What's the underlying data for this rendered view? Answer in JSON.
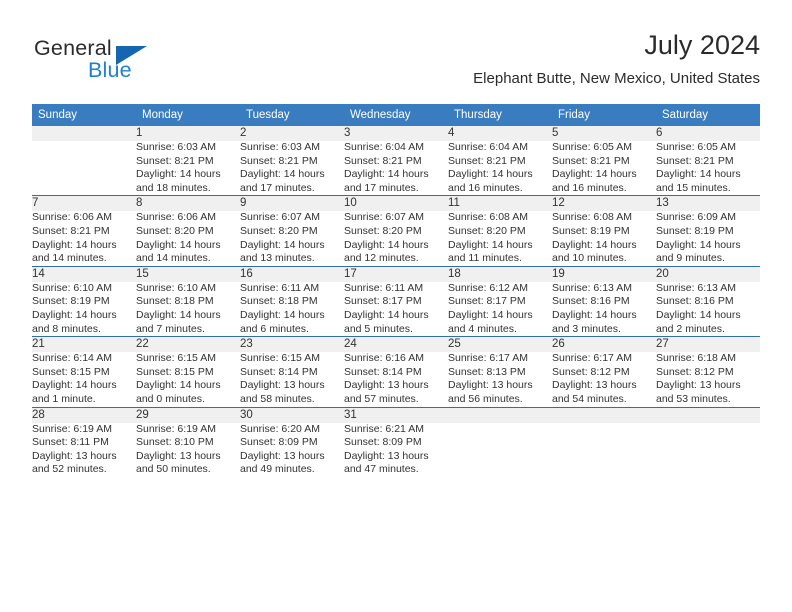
{
  "brand": {
    "name_top": "General",
    "name_bottom": "Blue",
    "accent_color": "#1f7fd0",
    "triangle_color": "#1565b0"
  },
  "header": {
    "title": "July 2024",
    "subtitle": "Elephant Butte, New Mexico, United States"
  },
  "theme": {
    "header_bg": "#3a7cc0",
    "daynum_bg": "#f0f0f0",
    "row_divider": "#2f6fae",
    "text": "#333333"
  },
  "weekdays": [
    "Sunday",
    "Monday",
    "Tuesday",
    "Wednesday",
    "Thursday",
    "Friday",
    "Saturday"
  ],
  "weeks": [
    {
      "days": [
        {
          "num": "",
          "sunrise": "",
          "sunset": "",
          "daylight1": "",
          "daylight2": ""
        },
        {
          "num": "1",
          "sunrise": "Sunrise: 6:03 AM",
          "sunset": "Sunset: 8:21 PM",
          "daylight1": "Daylight: 14 hours",
          "daylight2": "and 18 minutes."
        },
        {
          "num": "2",
          "sunrise": "Sunrise: 6:03 AM",
          "sunset": "Sunset: 8:21 PM",
          "daylight1": "Daylight: 14 hours",
          "daylight2": "and 17 minutes."
        },
        {
          "num": "3",
          "sunrise": "Sunrise: 6:04 AM",
          "sunset": "Sunset: 8:21 PM",
          "daylight1": "Daylight: 14 hours",
          "daylight2": "and 17 minutes."
        },
        {
          "num": "4",
          "sunrise": "Sunrise: 6:04 AM",
          "sunset": "Sunset: 8:21 PM",
          "daylight1": "Daylight: 14 hours",
          "daylight2": "and 16 minutes."
        },
        {
          "num": "5",
          "sunrise": "Sunrise: 6:05 AM",
          "sunset": "Sunset: 8:21 PM",
          "daylight1": "Daylight: 14 hours",
          "daylight2": "and 16 minutes."
        },
        {
          "num": "6",
          "sunrise": "Sunrise: 6:05 AM",
          "sunset": "Sunset: 8:21 PM",
          "daylight1": "Daylight: 14 hours",
          "daylight2": "and 15 minutes."
        }
      ]
    },
    {
      "days": [
        {
          "num": "7",
          "sunrise": "Sunrise: 6:06 AM",
          "sunset": "Sunset: 8:21 PM",
          "daylight1": "Daylight: 14 hours",
          "daylight2": "and 14 minutes."
        },
        {
          "num": "8",
          "sunrise": "Sunrise: 6:06 AM",
          "sunset": "Sunset: 8:20 PM",
          "daylight1": "Daylight: 14 hours",
          "daylight2": "and 14 minutes."
        },
        {
          "num": "9",
          "sunrise": "Sunrise: 6:07 AM",
          "sunset": "Sunset: 8:20 PM",
          "daylight1": "Daylight: 14 hours",
          "daylight2": "and 13 minutes."
        },
        {
          "num": "10",
          "sunrise": "Sunrise: 6:07 AM",
          "sunset": "Sunset: 8:20 PM",
          "daylight1": "Daylight: 14 hours",
          "daylight2": "and 12 minutes."
        },
        {
          "num": "11",
          "sunrise": "Sunrise: 6:08 AM",
          "sunset": "Sunset: 8:20 PM",
          "daylight1": "Daylight: 14 hours",
          "daylight2": "and 11 minutes."
        },
        {
          "num": "12",
          "sunrise": "Sunrise: 6:08 AM",
          "sunset": "Sunset: 8:19 PM",
          "daylight1": "Daylight: 14 hours",
          "daylight2": "and 10 minutes."
        },
        {
          "num": "13",
          "sunrise": "Sunrise: 6:09 AM",
          "sunset": "Sunset: 8:19 PM",
          "daylight1": "Daylight: 14 hours",
          "daylight2": "and 9 minutes."
        }
      ]
    },
    {
      "days": [
        {
          "num": "14",
          "sunrise": "Sunrise: 6:10 AM",
          "sunset": "Sunset: 8:19 PM",
          "daylight1": "Daylight: 14 hours",
          "daylight2": "and 8 minutes."
        },
        {
          "num": "15",
          "sunrise": "Sunrise: 6:10 AM",
          "sunset": "Sunset: 8:18 PM",
          "daylight1": "Daylight: 14 hours",
          "daylight2": "and 7 minutes."
        },
        {
          "num": "16",
          "sunrise": "Sunrise: 6:11 AM",
          "sunset": "Sunset: 8:18 PM",
          "daylight1": "Daylight: 14 hours",
          "daylight2": "and 6 minutes."
        },
        {
          "num": "17",
          "sunrise": "Sunrise: 6:11 AM",
          "sunset": "Sunset: 8:17 PM",
          "daylight1": "Daylight: 14 hours",
          "daylight2": "and 5 minutes."
        },
        {
          "num": "18",
          "sunrise": "Sunrise: 6:12 AM",
          "sunset": "Sunset: 8:17 PM",
          "daylight1": "Daylight: 14 hours",
          "daylight2": "and 4 minutes."
        },
        {
          "num": "19",
          "sunrise": "Sunrise: 6:13 AM",
          "sunset": "Sunset: 8:16 PM",
          "daylight1": "Daylight: 14 hours",
          "daylight2": "and 3 minutes."
        },
        {
          "num": "20",
          "sunrise": "Sunrise: 6:13 AM",
          "sunset": "Sunset: 8:16 PM",
          "daylight1": "Daylight: 14 hours",
          "daylight2": "and 2 minutes."
        }
      ]
    },
    {
      "days": [
        {
          "num": "21",
          "sunrise": "Sunrise: 6:14 AM",
          "sunset": "Sunset: 8:15 PM",
          "daylight1": "Daylight: 14 hours",
          "daylight2": "and 1 minute."
        },
        {
          "num": "22",
          "sunrise": "Sunrise: 6:15 AM",
          "sunset": "Sunset: 8:15 PM",
          "daylight1": "Daylight: 14 hours",
          "daylight2": "and 0 minutes."
        },
        {
          "num": "23",
          "sunrise": "Sunrise: 6:15 AM",
          "sunset": "Sunset: 8:14 PM",
          "daylight1": "Daylight: 13 hours",
          "daylight2": "and 58 minutes."
        },
        {
          "num": "24",
          "sunrise": "Sunrise: 6:16 AM",
          "sunset": "Sunset: 8:14 PM",
          "daylight1": "Daylight: 13 hours",
          "daylight2": "and 57 minutes."
        },
        {
          "num": "25",
          "sunrise": "Sunrise: 6:17 AM",
          "sunset": "Sunset: 8:13 PM",
          "daylight1": "Daylight: 13 hours",
          "daylight2": "and 56 minutes."
        },
        {
          "num": "26",
          "sunrise": "Sunrise: 6:17 AM",
          "sunset": "Sunset: 8:12 PM",
          "daylight1": "Daylight: 13 hours",
          "daylight2": "and 54 minutes."
        },
        {
          "num": "27",
          "sunrise": "Sunrise: 6:18 AM",
          "sunset": "Sunset: 8:12 PM",
          "daylight1": "Daylight: 13 hours",
          "daylight2": "and 53 minutes."
        }
      ]
    },
    {
      "days": [
        {
          "num": "28",
          "sunrise": "Sunrise: 6:19 AM",
          "sunset": "Sunset: 8:11 PM",
          "daylight1": "Daylight: 13 hours",
          "daylight2": "and 52 minutes."
        },
        {
          "num": "29",
          "sunrise": "Sunrise: 6:19 AM",
          "sunset": "Sunset: 8:10 PM",
          "daylight1": "Daylight: 13 hours",
          "daylight2": "and 50 minutes."
        },
        {
          "num": "30",
          "sunrise": "Sunrise: 6:20 AM",
          "sunset": "Sunset: 8:09 PM",
          "daylight1": "Daylight: 13 hours",
          "daylight2": "and 49 minutes."
        },
        {
          "num": "31",
          "sunrise": "Sunrise: 6:21 AM",
          "sunset": "Sunset: 8:09 PM",
          "daylight1": "Daylight: 13 hours",
          "daylight2": "and 47 minutes."
        },
        {
          "num": "",
          "sunrise": "",
          "sunset": "",
          "daylight1": "",
          "daylight2": ""
        },
        {
          "num": "",
          "sunrise": "",
          "sunset": "",
          "daylight1": "",
          "daylight2": ""
        },
        {
          "num": "",
          "sunrise": "",
          "sunset": "",
          "daylight1": "",
          "daylight2": ""
        }
      ]
    }
  ]
}
